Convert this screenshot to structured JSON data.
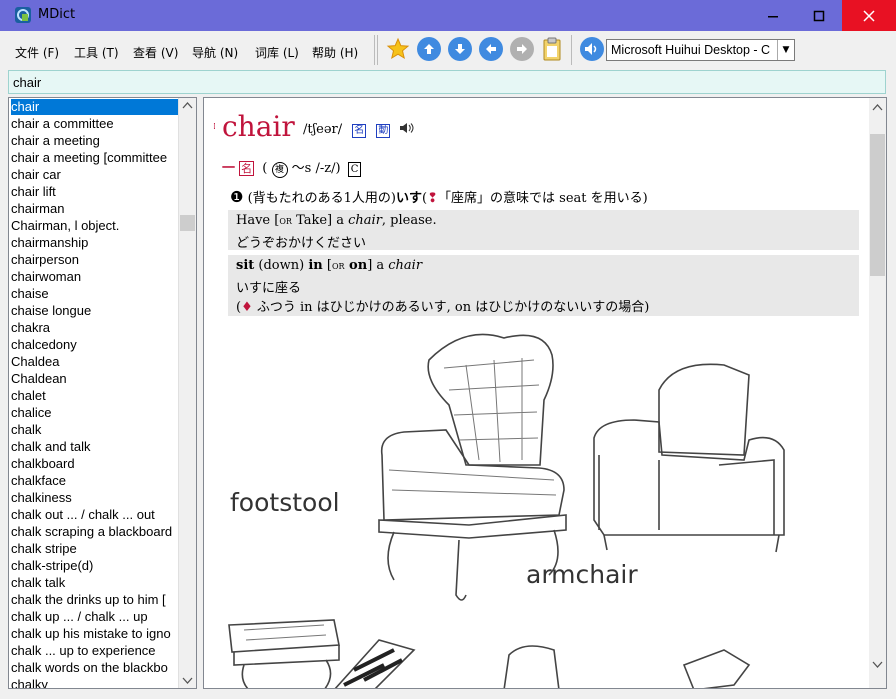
{
  "window": {
    "title": "MDict"
  },
  "menu": [
    "文件 (F)",
    "工具 (T)",
    "查看 (V)",
    "导航 (N)",
    "词库 (L)",
    "帮助 (H)"
  ],
  "toolbar": {
    "dictionary_selected": "Microsoft Huihui Desktop - C"
  },
  "search": {
    "value": "chair"
  },
  "wordlist": {
    "items": [
      "chair",
      "chair a committee",
      "chair a meeting",
      "chair a meeting [committee",
      "chair car",
      "chair lift",
      "chairman",
      "Chairman, l object.",
      "chairmanship",
      "chairperson",
      "chairwoman",
      "chaise",
      "chaise longue",
      "chakra",
      "chalcedony",
      "Chaldea",
      "Chaldean",
      "chalet",
      "chalice",
      "chalk",
      "chalk and talk",
      "chalkboard",
      "chalkface",
      "chalkiness",
      "chalk out ... / chalk ... out",
      "chalk scraping a blackboard",
      "chalk stripe",
      "chalk-stripe(d)",
      "chalk talk",
      "chalk the drinks up to him [",
      "chalk up ... / chalk ... up",
      "chalk up his mistake to igno",
      "chalk ... up to experience",
      "chalk words on the blackbo",
      "chalky"
    ],
    "selected_index": 0
  },
  "entry": {
    "headword": "chair",
    "pronunciation": "/tʃeər/",
    "badges": [
      "名",
      "動"
    ],
    "pos_marker": "一",
    "pos_badge": "名",
    "plural_marker": "複",
    "plural": "～s /-z/)",
    "countable": "C",
    "sense_number": "❶",
    "sense_text_1": "(背もたれのある1人用の)",
    "sense_headword": "いす",
    "sense_text_2": "(",
    "sense_note": "「座席」の意味では seat を用いる)",
    "examples": [
      {
        "line1_a": "Have [",
        "line1_or": "OR",
        "line1_b": " Take] a ",
        "line1_it": "chair",
        "line1_c": ", please.",
        "line2": "どうぞおかけください"
      },
      {
        "line1_a": "sit",
        "line1_b": " (down) ",
        "line1_c": "in",
        "line1_d": " [",
        "line1_or": "OR",
        "line1_e": " on",
        "line1_f": "] a ",
        "line1_it": "chair",
        "line2": "いすに座る",
        "line3_a": "(",
        "line3_mark": "♦",
        "line3_b": " ふつう in はひじかけのあるいす, on はひじかけのないいすの場合)"
      }
    ],
    "illustration_labels": {
      "footstool": "footstool",
      "armchair": "armchair"
    }
  },
  "colors": {
    "titlebar": "#6b6bd8",
    "headword": "#c0143c",
    "selection": "#0078d7",
    "search_bg": "#e6f7f5"
  }
}
